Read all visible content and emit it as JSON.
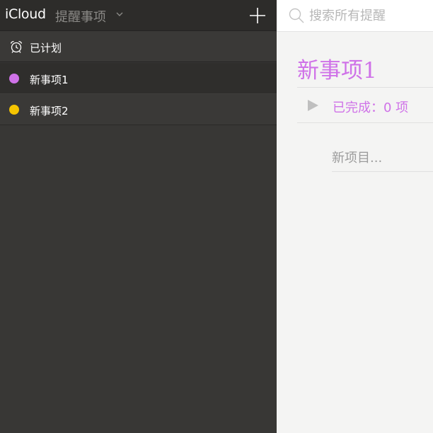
{
  "header": {
    "brand": "iCloud",
    "app_title": "提醒事项",
    "chevron_icon": "chevron-down-icon",
    "add_icon": "plus-icon"
  },
  "sidebar": {
    "scheduled": {
      "label": "已计划",
      "icon": "alarm-clock-icon"
    },
    "lists": [
      {
        "label": "新事项1",
        "color": "#cf72e8",
        "selected": true
      },
      {
        "label": "新事项2",
        "color": "#f5c400",
        "selected": false
      }
    ]
  },
  "search": {
    "placeholder": "搜索所有提醒",
    "value": "",
    "icon": "search-icon"
  },
  "main": {
    "title": "新事项1",
    "accent": "#cf72e8",
    "completed_label": "已完成：0 项",
    "completed_icon": "play-triangle-icon",
    "new_item_placeholder": "新项目..."
  }
}
